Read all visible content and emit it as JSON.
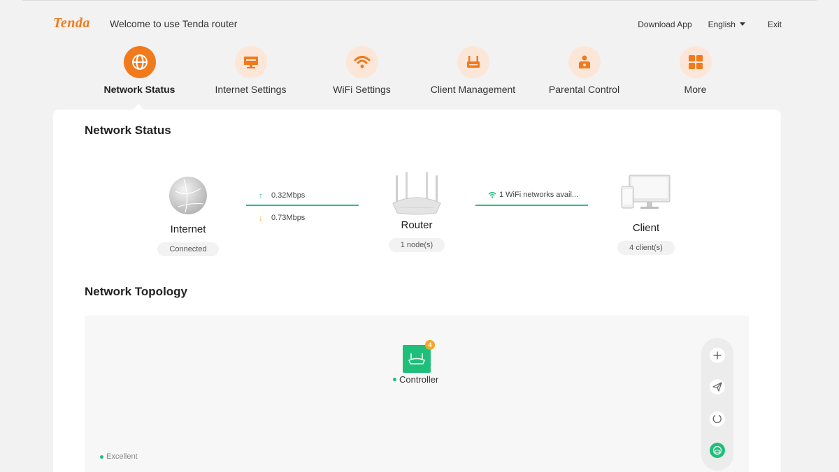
{
  "header": {
    "logo": "Tenda",
    "welcome": "Welcome to use Tenda router",
    "download_app": "Download App",
    "language": "English",
    "exit": "Exit"
  },
  "nav": {
    "items": [
      {
        "label": "Network Status",
        "icon": "globe-icon",
        "active": true
      },
      {
        "label": "Internet Settings",
        "icon": "monitor-icon",
        "active": false
      },
      {
        "label": "WiFi Settings",
        "icon": "wifi-icon",
        "active": false
      },
      {
        "label": "Client Management",
        "icon": "router-icon",
        "active": false
      },
      {
        "label": "Parental Control",
        "icon": "family-icon",
        "active": false
      },
      {
        "label": "More",
        "icon": "grid-icon",
        "active": false
      }
    ]
  },
  "network_status": {
    "title": "Network Status",
    "internet": {
      "name": "Internet",
      "status": "Connected"
    },
    "upload_speed": "0.32Mbps",
    "download_speed": "0.73Mbps",
    "router": {
      "name": "Router",
      "status": "1 node(s)"
    },
    "wifi_info": "1 WiFi networks avail...",
    "client": {
      "name": "Client",
      "status": "4 client(s)"
    }
  },
  "topology": {
    "title": "Network Topology",
    "controller_label": "Controller",
    "controller_badge": "4",
    "legend_excellent": "Excellent",
    "tools": [
      "plus-icon",
      "send-icon",
      "refresh-icon",
      "router-view-icon"
    ]
  },
  "colors": {
    "brand_orange": "#f07a1c",
    "nav_circle_bg": "#fce6d8",
    "link_green": "#2bbf87",
    "controller_green": "#1fbf7a",
    "badge_orange": "#f5a623"
  }
}
